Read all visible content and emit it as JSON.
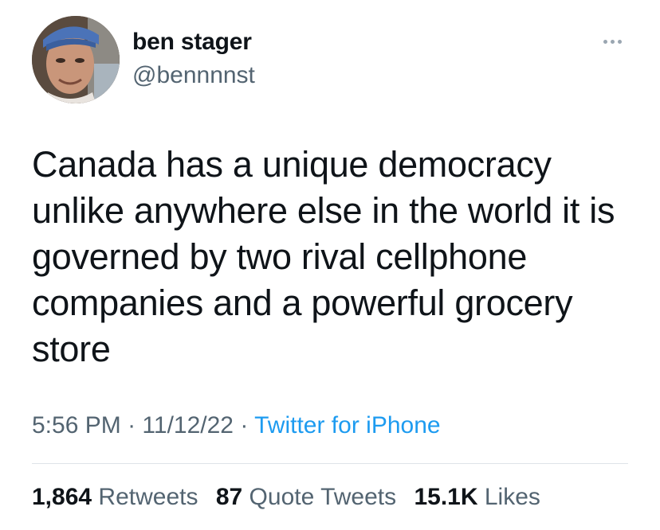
{
  "author": {
    "display_name": "ben stager",
    "handle": "@bennnnst"
  },
  "tweet": {
    "text": "Canada has a unique democracy unlike anywhere else in the world it is governed by two rival cellphone companies and a powerful grocery store",
    "time": "5:56 PM",
    "separator": "·",
    "date": "11/12/22",
    "source": "Twitter for iPhone"
  },
  "stats": {
    "retweets_count": "1,864",
    "retweets_label": "Retweets",
    "quotes_count": "87",
    "quotes_label": "Quote Tweets",
    "likes_count": "15.1K",
    "likes_label": "Likes"
  },
  "icons": {
    "more": "more-options-icon"
  },
  "colors": {
    "text": "#0f1419",
    "secondary": "#536471",
    "link": "#1d9bf0",
    "divider": "#dfe4e8"
  }
}
